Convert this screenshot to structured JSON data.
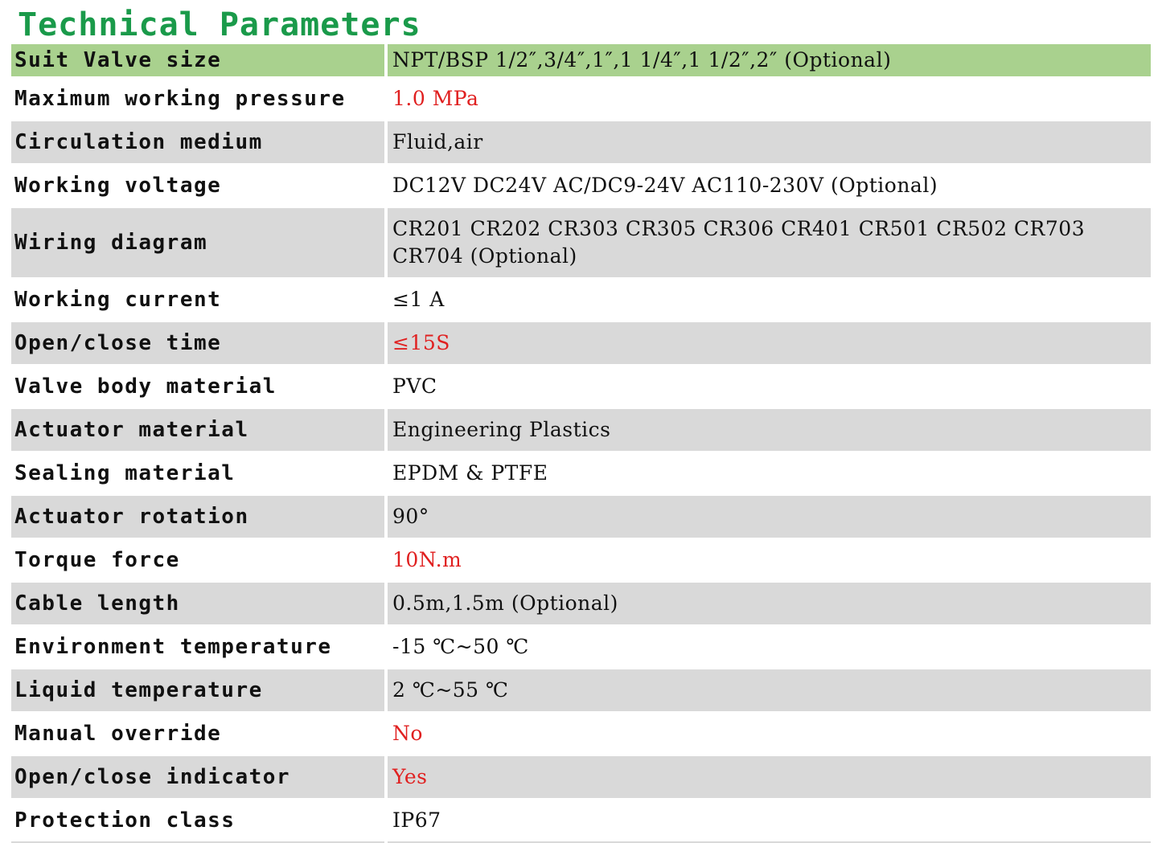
{
  "title": "Technical Parameters",
  "rows": [
    {
      "label": "Suit Valve size",
      "value": "NPT/BSP 1/2″,3/4″,1″,1 1/4″,1 1/2″,2″ (Optional)"
    },
    {
      "label": "Maximum working pressure",
      "value": "1.0 MPa"
    },
    {
      "label": "Circulation medium",
      "value": "Fluid,air"
    },
    {
      "label": "Working voltage",
      "value": "DC12V DC24V AC/DC9-24V AC110-230V (Optional)"
    },
    {
      "label": "Wiring diagram",
      "value": "CR201 CR202 CR303 CR305 CR306 CR401 CR501 CR502 CR703 CR704 (Optional)"
    },
    {
      "label": "Working current",
      "value": "≤1 A"
    },
    {
      "label": "Open/close time",
      "value": "≤15S"
    },
    {
      "label": "Valve body material",
      "value": "PVC"
    },
    {
      "label": "Actuator material",
      "value": "Engineering Plastics"
    },
    {
      "label": "Sealing material",
      "value": "EPDM & PTFE"
    },
    {
      "label": "Actuator rotation",
      "value": "90°"
    },
    {
      "label": "Torque force",
      "value": "10N.m"
    },
    {
      "label": "Cable length",
      "value": "0.5m,1.5m (Optional)"
    },
    {
      "label": "Environment temperature",
      "value": "-15 ℃~50 ℃"
    },
    {
      "label": "Liquid temperature",
      "value": "2 ℃~55 ℃"
    },
    {
      "label": "Manual override",
      "value": "No"
    },
    {
      "label": "Open/close indicator",
      "value": "Yes"
    },
    {
      "label": "Protection class",
      "value": "IP67"
    }
  ],
  "colors": {
    "title": "#1a9a4a",
    "header_row": "#a9d18e",
    "shaded_row": "#d9d9d9",
    "highlight_text": "#e02020"
  }
}
